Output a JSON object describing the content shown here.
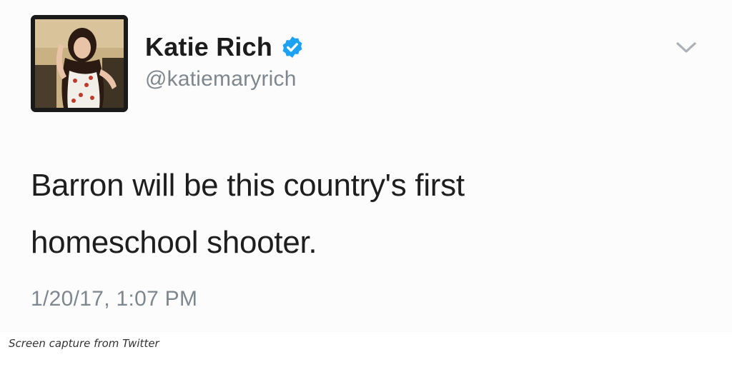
{
  "tweet": {
    "display_name": "Katie Rich",
    "handle": "@katiemaryrich",
    "verified": true,
    "text_line1": "Barron will be this country's first",
    "text_line2": "homeschool shooter.",
    "timestamp": "1/20/17, 1:07 PM"
  },
  "caption": "Screen capture from Twitter",
  "colors": {
    "verified_badge": "#1da1f2",
    "secondary_text": "#7e878e",
    "primary_text": "#1e1e1e"
  },
  "icons": {
    "verified": "verified-badge-icon",
    "menu": "chevron-down-icon"
  }
}
